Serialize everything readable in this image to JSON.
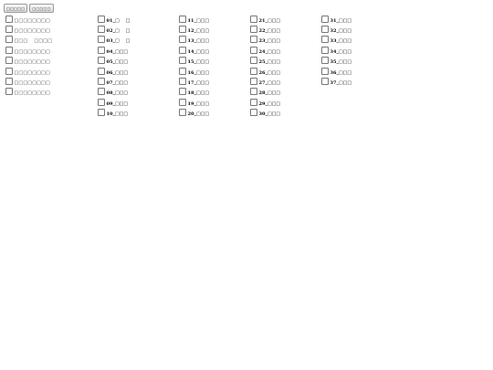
{
  "toolbar": {
    "buttons": [
      "□□□□□",
      "□□□□□"
    ]
  },
  "groups": [
    {
      "label": "□□□□□□□□"
    },
    {
      "label": "□□□□□□□□"
    },
    {
      "label": "□□□    □□□□"
    },
    {
      "label": "□□□□□□□□"
    },
    {
      "label": "□□□□□□□□"
    },
    {
      "label": "□□□□□□□□"
    },
    {
      "label": "□□□□□□□□"
    },
    {
      "label": "□□□□□□□□"
    }
  ],
  "items_col2": [
    {
      "label": "01_□    □"
    },
    {
      "label": "02_□    □"
    },
    {
      "label": "03_□    □"
    },
    {
      "label": "04_□□□"
    },
    {
      "label": "05_□□□"
    },
    {
      "label": "06_□□□"
    },
    {
      "label": "07_□□□"
    },
    {
      "label": "08_□□□"
    },
    {
      "label": "09_□□□"
    },
    {
      "label": "10_□□□"
    }
  ],
  "items_col3": [
    {
      "label": "11_□□□"
    },
    {
      "label": "12_□□□"
    },
    {
      "label": "13_□□□"
    },
    {
      "label": "14_□□□"
    },
    {
      "label": "15_□□□"
    },
    {
      "label": "16_□□□"
    },
    {
      "label": "17_□□□"
    },
    {
      "label": "18_□□□"
    },
    {
      "label": "19_□□□"
    },
    {
      "label": "20_□□□"
    }
  ],
  "items_col4": [
    {
      "label": "21_□□□"
    },
    {
      "label": "22_□□□"
    },
    {
      "label": "23_□□□"
    },
    {
      "label": "24_□□□"
    },
    {
      "label": "25_□□□"
    },
    {
      "label": "26_□□□"
    },
    {
      "label": "27_□□□"
    },
    {
      "label": "28_□□□"
    },
    {
      "label": "29_□□□"
    },
    {
      "label": "30_□□□"
    }
  ],
  "items_col5": [
    {
      "label": "31_□□□"
    },
    {
      "label": "32_□□□"
    },
    {
      "label": "33_□□□"
    },
    {
      "label": "34_□□□"
    },
    {
      "label": "35_□□□"
    },
    {
      "label": "36_□□□"
    },
    {
      "label": "37_□□□"
    }
  ]
}
